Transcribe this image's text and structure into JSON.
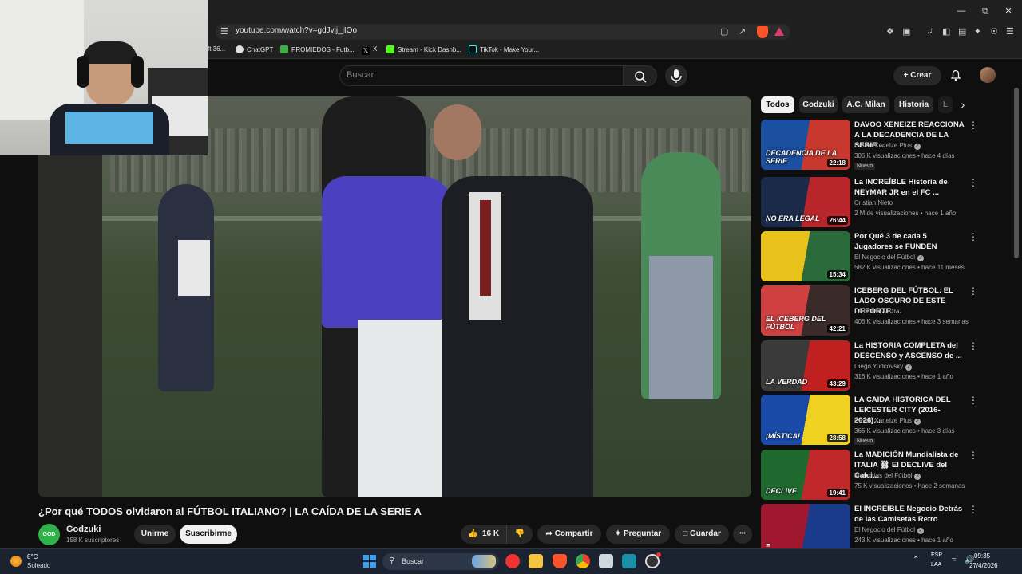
{
  "browser": {
    "url": "youtube.com/watch?v=gdJvij_jIOo",
    "window_controls": {
      "minimize": "—",
      "restore": "⧉",
      "close": "✕"
    },
    "bookmarks": [
      {
        "label": "ft 36...",
        "color": "#3a7bd5"
      },
      {
        "label": "ChatGPT",
        "color": "#e0e0e0"
      },
      {
        "label": "PROMIEDOS - Futb...",
        "color": "#3cb043"
      },
      {
        "label": "X",
        "color": "#111111"
      },
      {
        "label": "Stream - Kick Dashb...",
        "color": "#53fc18"
      },
      {
        "label": "TikTok - Make Your...",
        "color": "#111111"
      }
    ]
  },
  "header": {
    "search_placeholder": "Buscar",
    "create_label": "Crear"
  },
  "video": {
    "title": "¿Por qué TODOS olvidaron al FÚTBOL ITALIANO? | LA CAÍDA DE LA SERIE A",
    "channel": "Godzuki",
    "channel_avatar_text": "GOD ZUKI",
    "subscribers": "158 K suscriptores",
    "join_label": "Unirme",
    "subscribe_label": "Suscribirme",
    "likes": "16 K",
    "share_label": "Compartir",
    "ask_label": "Preguntar",
    "save_label": "Guardar",
    "more_label": "•••"
  },
  "chips": [
    "Todos",
    "Godzuki",
    "A.C. Milan",
    "Historia",
    "L"
  ],
  "recommendations": [
    {
      "title": "DAVOO XENEIZE REACCIONA A LA DECADENCIA DE LA SERIE ...",
      "channel": "Davoo Xeneize Plus",
      "verified": true,
      "views": "306 K visualizaciones • hace 4 días",
      "badge": "Nuevo",
      "duration": "22:18",
      "thumb_text": "DECADENCIA DE LA SERIE",
      "colors": [
        "#1b4fa0",
        "#c8382e"
      ]
    },
    {
      "title": "La INCREÍBLE Historia de NEYMAR JR en el FC ...",
      "channel": "Cristian Nieto",
      "verified": false,
      "views": "2 M de visualizaciones • hace 1 año",
      "badge": "",
      "duration": "26:44",
      "thumb_text": "NO ERA LEGAL",
      "colors": [
        "#1c2a4a",
        "#b8262b"
      ]
    },
    {
      "title": "Por Qué 3 de cada 5 Jugadores se FUNDEN",
      "channel": "El Negocio del Fútbol",
      "verified": true,
      "views": "582 K visualizaciones • hace 11 meses",
      "badge": "",
      "duration": "15:34",
      "thumb_text": "",
      "colors": [
        "#e8c21a",
        "#2a6a3a"
      ]
    },
    {
      "title": "ICEBERG DEL FÚTBOL: EL LADO OSCURO DE ESTE DEPORTE. ...",
      "channel": "LA COBRA Xtra",
      "verified": false,
      "views": "406 K visualizaciones • hace 3 semanas",
      "badge": "",
      "duration": "42:21",
      "thumb_text": "EL ICEBERG DEL FÚTBOL",
      "colors": [
        "#d04040",
        "#3a2a2a"
      ]
    },
    {
      "title": "La HISTORIA COMPLETA del DESCENSO y ASCENSO de ...",
      "channel": "Diego Yudcovsky",
      "verified": true,
      "views": "316 K visualizaciones • hace 1 año",
      "badge": "",
      "duration": "43:29",
      "thumb_text": "LA VERDAD",
      "colors": [
        "#3a3a3a",
        "#c02020"
      ]
    },
    {
      "title": "LA CAIDA HISTORICA DEL LEICESTER CITY (2016-2026):...",
      "channel": "Davoo Xeneize Plus",
      "verified": true,
      "views": "366 K visualizaciones • hace 3 días",
      "badge": "Nuevo",
      "duration": "28:58",
      "thumb_text": "¡MÍSTICA!",
      "colors": [
        "#1a4aa8",
        "#f0d020"
      ]
    },
    {
      "title": "La MADICIÓN Mundialista de ITALIA ⛓ El DECLIVE del Calci...",
      "channel": "Memorias del Fútbol",
      "verified": true,
      "views": "75 K visualizaciones • hace 2 semanas",
      "badge": "",
      "duration": "19:41",
      "thumb_text": "DECLIVE",
      "colors": [
        "#1e6a2e",
        "#c0282a"
      ]
    },
    {
      "title": "El INCREÍBLE Negocio Detrás de las Camisetas Retro",
      "channel": "El Negocio del Fútbol",
      "verified": true,
      "views": "243 K visualizaciones • hace 1 año",
      "badge": "",
      "duration": "",
      "thumb_text": "=",
      "colors": [
        "#a01830",
        "#1a3a8a"
      ]
    }
  ],
  "taskbar": {
    "temperature": "8°C",
    "weather": "Soleado",
    "search_placeholder": "Buscar",
    "lang": "ESP",
    "layout": "LAA",
    "time": "09:35",
    "date": "27/4/2026"
  }
}
